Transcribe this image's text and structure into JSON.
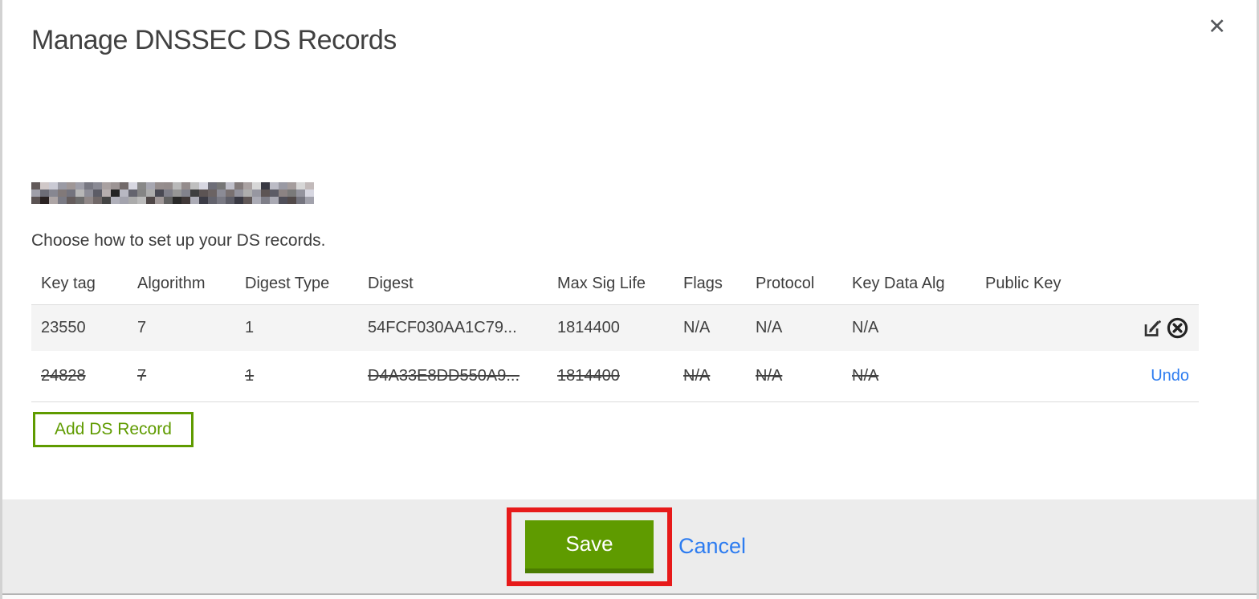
{
  "modal": {
    "title": "Manage DNSSEC DS Records",
    "close_glyph": "✕",
    "instruction": "Choose how to set up your DS records.",
    "table": {
      "headers": [
        "Key tag",
        "Algorithm",
        "Digest Type",
        "Digest",
        "Max Sig Life",
        "Flags",
        "Protocol",
        "Key Data Alg",
        "Public Key"
      ],
      "rows": [
        {
          "key_tag": "23550",
          "algorithm": "7",
          "digest_type": "1",
          "digest": "54FCF030AA1C79...",
          "max_sig_life": "1814400",
          "flags": "N/A",
          "protocol": "N/A",
          "key_data_alg": "N/A",
          "public_key": "",
          "state": "normal"
        },
        {
          "key_tag": "24828",
          "algorithm": "7",
          "digest_type": "1",
          "digest": "D4A33E8DD550A9...",
          "max_sig_life": "1814400",
          "flags": "N/A",
          "protocol": "N/A",
          "key_data_alg": "N/A",
          "public_key": "",
          "state": "deleted",
          "undo_label": "Undo"
        }
      ]
    },
    "add_button_label": "Add DS Record",
    "footer": {
      "save_label": "Save",
      "cancel_label": "Cancel"
    }
  },
  "colors": {
    "green": "#5f9b00",
    "green_dark": "#4b7c00",
    "link_blue": "#2d7cf0",
    "annotation_red": "#e71a1a",
    "footer_bg": "#ececec",
    "row_alt_bg": "#f4f4f4",
    "table_border": "#dcdcdc",
    "text": "#404040"
  }
}
